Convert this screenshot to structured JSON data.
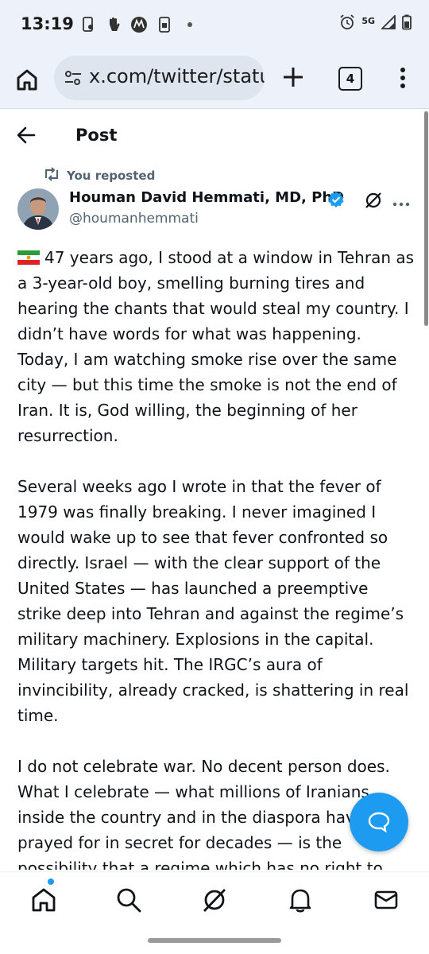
{
  "status_bar": {
    "time": "13:19",
    "network": "5G"
  },
  "browser": {
    "url": "x.com/twitter/statu",
    "tab_count": "4"
  },
  "header": {
    "title": "Post"
  },
  "post": {
    "repost_label": "You reposted",
    "author_name": "Houman David Hemmati, MD, PhD",
    "handle": "@houmanhemmati",
    "paragraphs": [
      "47 years ago, I stood at a window in Tehran as a 3-year-old boy, smelling burning tires and hearing the chants that would steal my country. I didn’t have words for what was happening. Today, I am watching smoke rise over the same city — but this time the smoke is not the end of Iran. It is, God willing, the beginning of her resurrection.",
      "Several weeks ago I wrote in that the fever of 1979 was finally breaking. I never imagined I would wake up to see that fever confronted so directly. Israel — with the clear support of the United States — has launched a preemptive strike deep into Tehran and against the regime’s military machinery. Explosions in the capital. Military targets hit. The IRGC’s aura of invincibility, already cracked, is shattering in real time.",
      "I do not celebrate war. No decent person does. What I celebrate — what millions of Iranians inside the country and in the diaspora have prayed for in secret for decades — is the possibility that a regime which has no right to"
    ]
  },
  "icons": {
    "status_left": [
      "screenshot-icon",
      "hand-icon",
      "motorola-icon",
      "sim-icon",
      "dot-icon"
    ],
    "status_right": [
      "alarm-icon",
      "signal-icon",
      "battery-icon"
    ],
    "nav": [
      "home-icon",
      "search-icon",
      "grok-icon",
      "notifications-icon",
      "messages-icon"
    ]
  },
  "colors": {
    "accent": "#1d9bf0",
    "browser_bar": "#edf2fa",
    "url_pill": "#dfe5ee",
    "secondary_text": "#536471"
  }
}
